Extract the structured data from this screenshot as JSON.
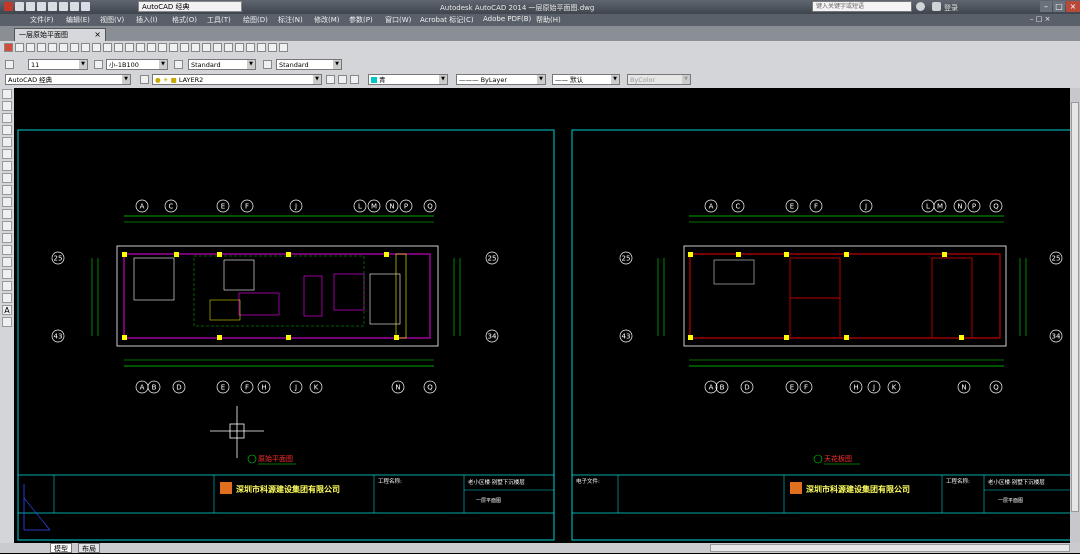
{
  "titlebar": {
    "workspace": "AutoCAD 经典",
    "app_title": "Autodesk AutoCAD 2014    一层原始平面图.dwg",
    "search_placeholder": "键入关键字或短语",
    "login": "登录",
    "minimize": "–",
    "maximize": "□",
    "close": "×"
  },
  "menu": [
    "文件(F)",
    "编辑(E)",
    "视图(V)",
    "插入(I)",
    "格式(O)",
    "工具(T)",
    "绘图(D)",
    "标注(N)",
    "修改(M)",
    "参数(P)",
    "窗口(W)",
    "Acrobat 标记(C)",
    "Adobe PDF(B)",
    "帮助(H)"
  ],
  "doc_tab": "一层原始平面图",
  "toolbar2": {
    "text_height": "11",
    "scale": "小-1B100",
    "text_style": "Standard",
    "dim_style": "Standard"
  },
  "toolbar3": {
    "workspace": "AutoCAD 经典",
    "layer": "LAYER2",
    "color": "青",
    "linetype": "ByLayer",
    "lineweight": "默认",
    "plotstyle": "ByColor"
  },
  "drawing": {
    "axis_top": [
      "A",
      "C",
      "E",
      "F",
      "J",
      "L",
      "M",
      "N",
      "P",
      "Q"
    ],
    "axis_bottom_left": [
      "A",
      "B",
      "D",
      "E",
      "F",
      "H",
      "J",
      "K",
      "N",
      "Q"
    ],
    "axis_bottom_right": [
      "A",
      "B",
      "D",
      "E",
      "F",
      "H",
      "J",
      "K",
      "N",
      "Q"
    ],
    "axis_side_top": "25",
    "axis_side_bottom": "43",
    "axis_side_bottom_right": "34",
    "caption_left": "原始平面图",
    "caption_right": "天花板图",
    "company": "深圳市科源建设集团有限公司",
    "project_label": "工程名称:",
    "project_label_right": "电子文件:",
    "drawing_name": "一层平面图",
    "project_name": "老小区楼·别墅下沉楼层"
  },
  "layout_tabs": [
    "模型",
    "布局"
  ]
}
